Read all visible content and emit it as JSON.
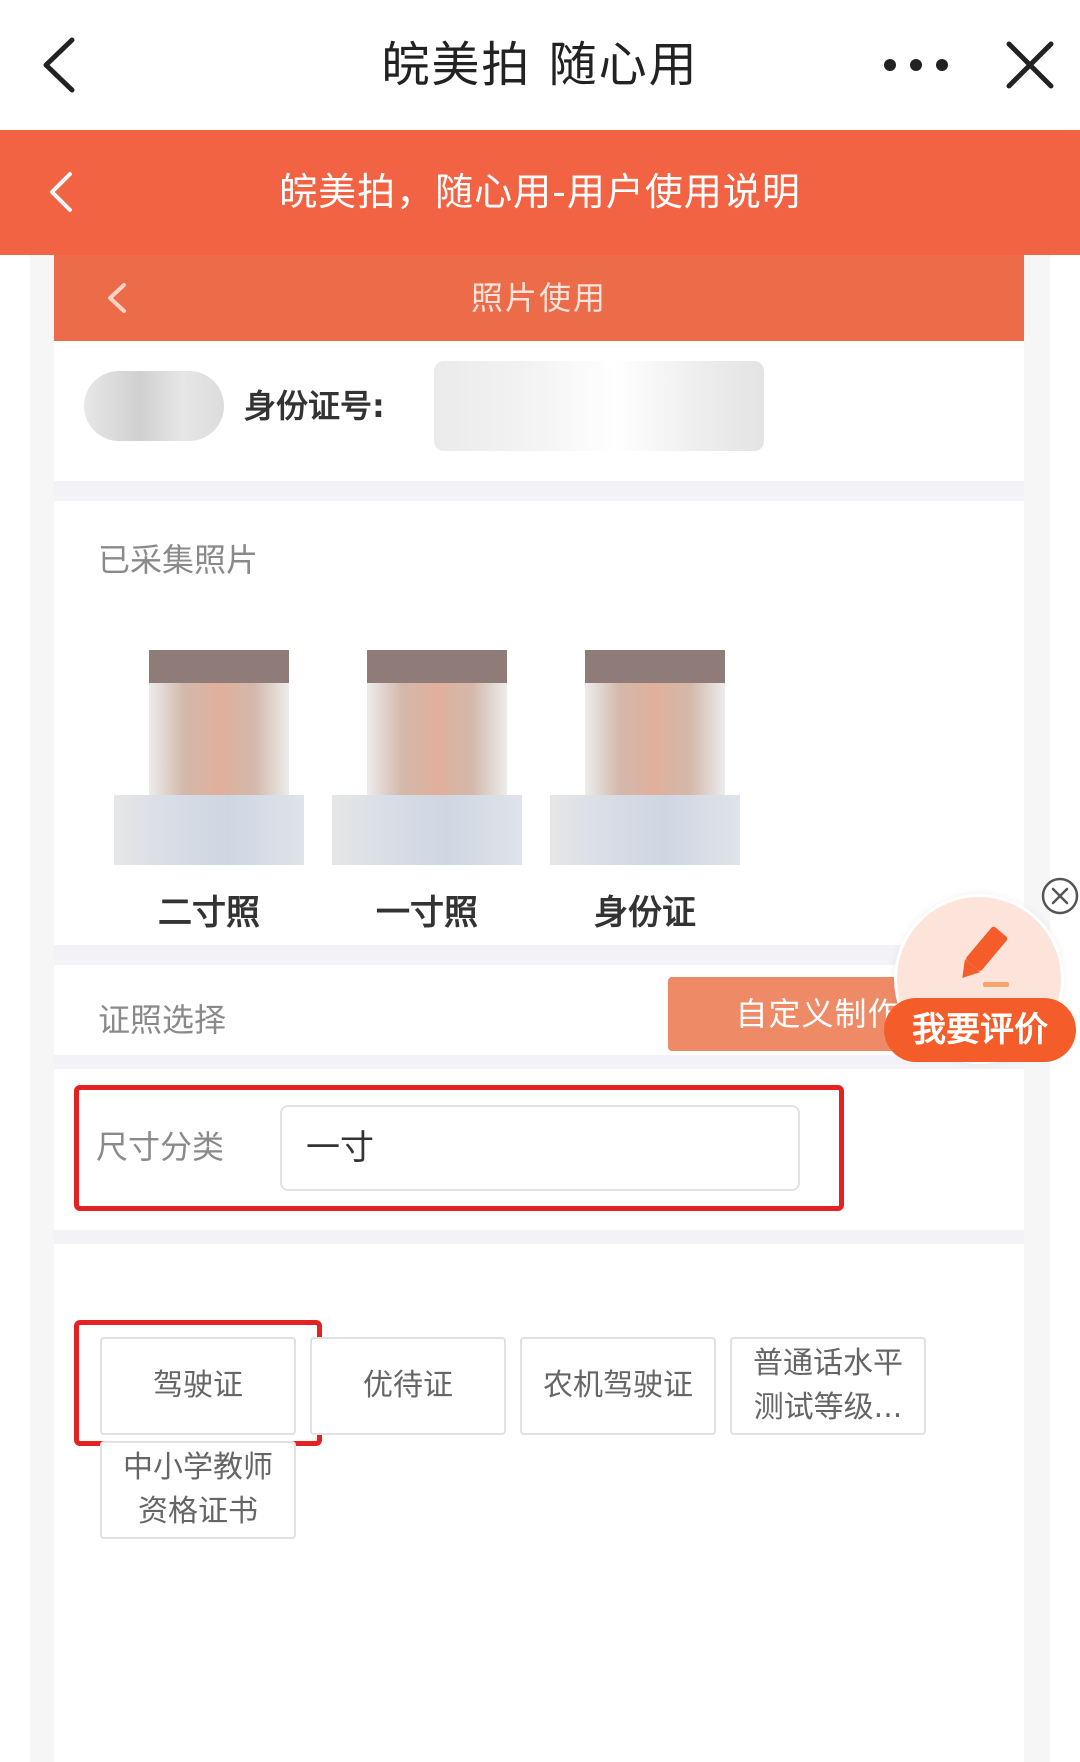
{
  "top_bar": {
    "title": "皖美拍 随心用"
  },
  "orange_header": {
    "title": "皖美拍，随心用-用户使用说明"
  },
  "inner_header": {
    "title": "照片使用"
  },
  "id_row": {
    "label": "身份证号:"
  },
  "collected_section": {
    "title": "已采集照片",
    "photos": [
      {
        "caption": "二寸照"
      },
      {
        "caption": "一寸照"
      },
      {
        "caption": "身份证"
      }
    ]
  },
  "cert_section": {
    "title": "证照选择",
    "custom_button": "自定义制作"
  },
  "size_row": {
    "label": "尺寸分类",
    "value": "一寸"
  },
  "cert_types": [
    "驾驶证",
    "优待证",
    "农机驾驶证",
    "普通话水平测试等级...",
    "中小学教师资格证书"
  ],
  "review_widget": {
    "label": "我要评价"
  },
  "colors": {
    "brand_orange": "#f26343",
    "highlight_red": "#e52222",
    "custom_button": "#ef8a66"
  }
}
